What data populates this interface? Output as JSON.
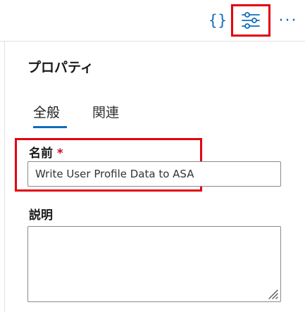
{
  "toolbar": {
    "code_icon_glyph": "{}",
    "properties_icon": "sliders-icon",
    "more_glyph": "···",
    "accent_color": "#0f6cbd",
    "highlight_color": "#e3000f"
  },
  "panel": {
    "title": "プロパティ",
    "tabs": [
      {
        "label": "全般",
        "selected": true
      },
      {
        "label": "関連",
        "selected": false
      }
    ],
    "name": {
      "label": "名前",
      "required_mark": "*",
      "value": "Write User Profile Data to ASA"
    },
    "description": {
      "label": "説明",
      "value": ""
    }
  }
}
